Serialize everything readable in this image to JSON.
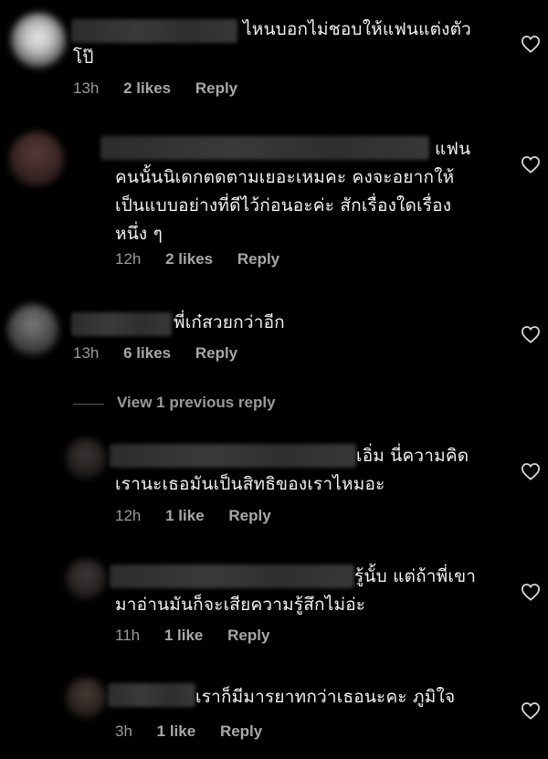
{
  "comments": [
    {
      "text_lines": [
        "ไหนบอกไม่ชอบให้แฟนแต่งตัว",
        "โป๊"
      ],
      "time": "13h",
      "likes": "2 likes",
      "reply": "Reply"
    },
    {
      "text_lines": [
        "แฟน",
        "คนนั้นนิเดกตดตามเยอะเหมคะ คงจะอยากให้",
        "เป็นแบบอย่างที่ดีไว้ก่อนอะค่ะ สักเรื่องใดเรื่อง",
        "หนึ่ง ๆ"
      ],
      "time": "12h",
      "likes": "2 likes",
      "reply": "Reply"
    },
    {
      "text_lines": [
        "พี่เก๋สวยกว่าอีก"
      ],
      "time": "13h",
      "likes": "6 likes",
      "reply": "Reply"
    },
    {
      "text_lines": [
        "เอิ่ม นี่ความคิด",
        "เรานะเธอมันเป็นสิทธิของเราไหมอะ"
      ],
      "time": "12h",
      "likes": "1 like",
      "reply": "Reply"
    },
    {
      "text_lines": [
        "รู้นั้บ แต่ถ้าพี่เขา",
        "มาอ่านมันก็จะเสียความรู้สึกไม่อ่ะ"
      ],
      "time": "11h",
      "likes": "1 like",
      "reply": "Reply"
    },
    {
      "text_lines": [
        "เราก็มีมารยาทกว่าเธอนะคะ ภูมิใจ"
      ],
      "time": "3h",
      "likes": "1 like",
      "reply": "Reply"
    }
  ],
  "view_replies": "View 1 previous reply",
  "icons": {
    "like": "heart-outline-icon"
  },
  "colors": {
    "background": "#000000",
    "text": "#f2f2f2",
    "meta": "#9a9a9a"
  }
}
